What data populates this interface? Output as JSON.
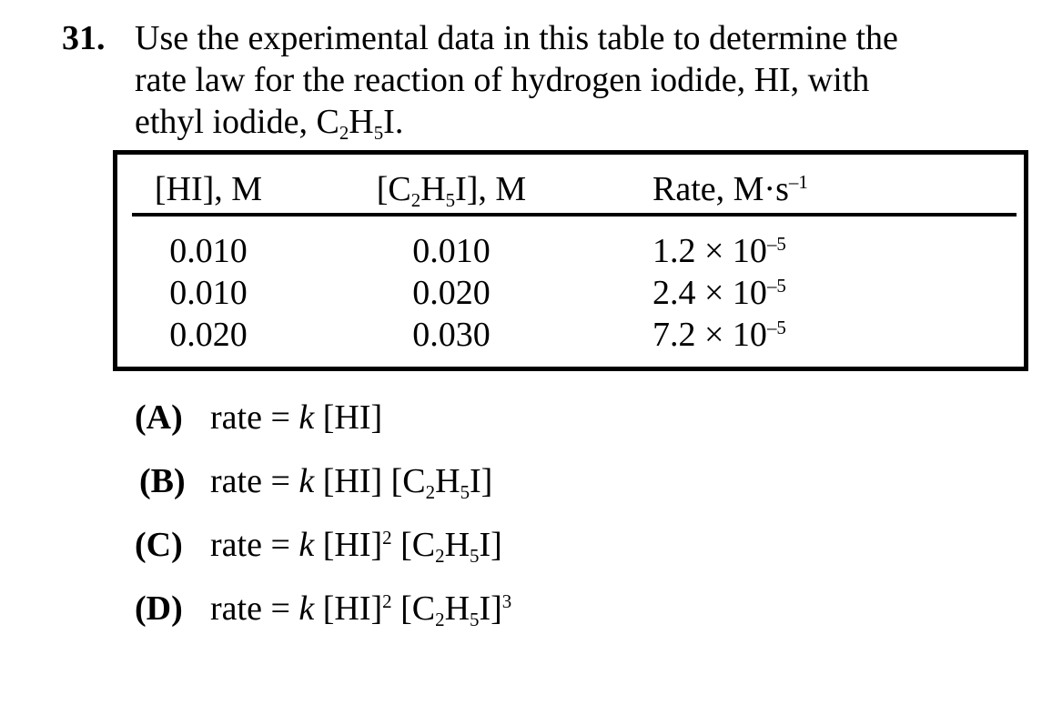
{
  "question": {
    "number": "31.",
    "stem_lines": [
      "Use the experimental data in this table to determine the",
      "rate law for the reaction of hydrogen iodide, HI, with",
      "ethyl iodide, C2H5I."
    ]
  },
  "table": {
    "headers": [
      "[HI], M",
      "[C2H5I], M",
      "Rate, M·s–1"
    ],
    "rows": [
      [
        "0.010",
        "0.010",
        "1.2 × 10–5"
      ],
      [
        "0.010",
        "0.020",
        "2.4 × 10–5"
      ],
      [
        "0.020",
        "0.030",
        "7.2 × 10–5"
      ]
    ]
  },
  "choices": [
    {
      "letter": "(A)",
      "text": "rate = k [HI]"
    },
    {
      "letter": "(B)",
      "text": "rate = k [HI] [C2H5I]"
    },
    {
      "letter": "(C)",
      "text": "rate = k [HI]2 [C2H5I]"
    },
    {
      "letter": "(D)",
      "text": "rate = k [HI]2 [C2H5I]3"
    }
  ]
}
